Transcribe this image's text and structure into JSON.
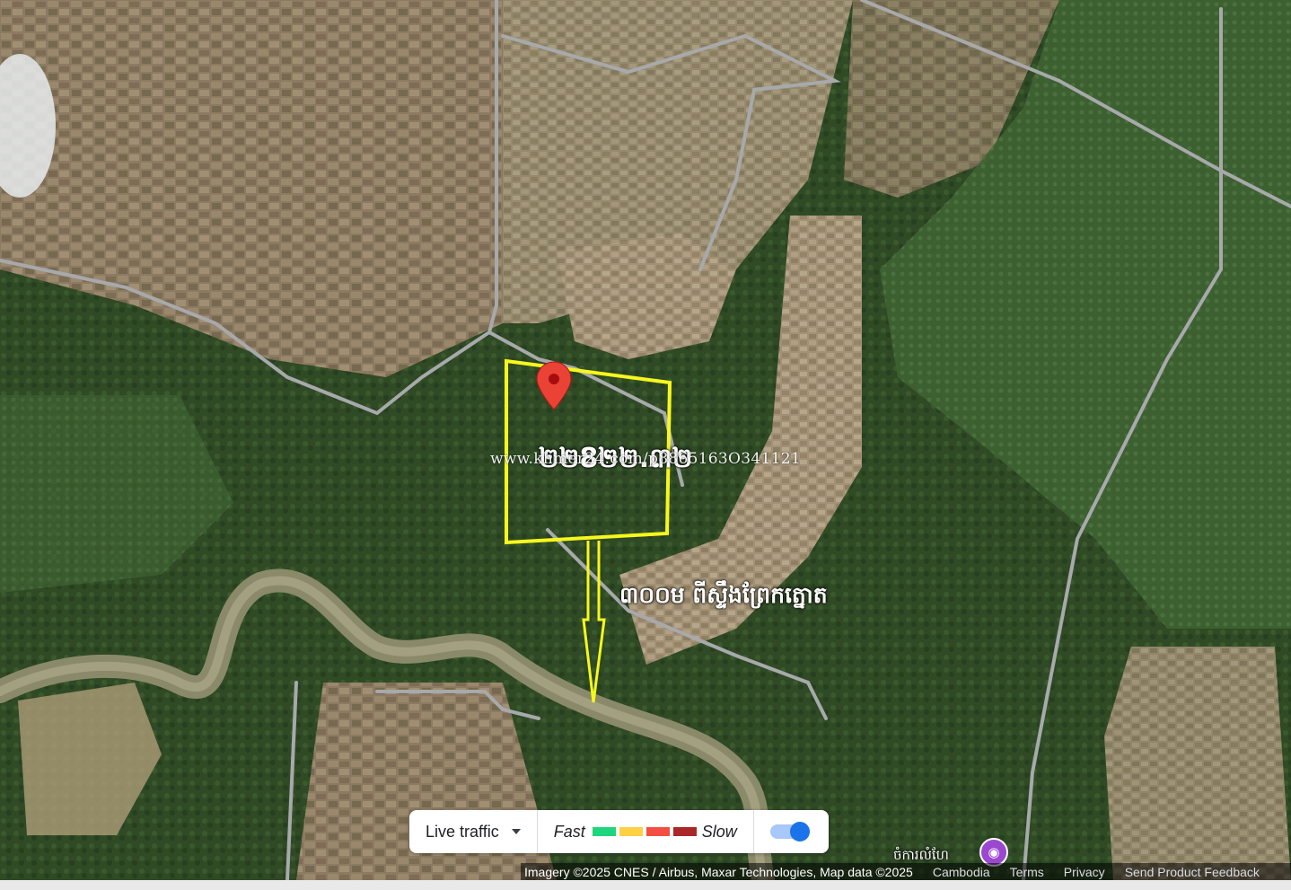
{
  "map": {
    "type": "satellite",
    "area_label": "២២8២២.៣២",
    "distance_label": "៣០០ម ពីស្ទឹងព្រែកត្នោត",
    "watermark": "www.khmer24.com/p8865163O341121",
    "colors": {
      "annotation": "#f7f71d",
      "pin": "#ea4335",
      "river": "#8a8a6a",
      "forest": "#2f4a25"
    }
  },
  "traffic": {
    "live_label": "Live traffic",
    "fast_label": "Fast",
    "slow_label": "Slow",
    "legend_colors": [
      "#1ed67c",
      "#ffcf44",
      "#f24e42",
      "#a92727"
    ],
    "toggle_on": true
  },
  "poi": {
    "label": "ចំការលំហែ",
    "icon": "camera-icon"
  },
  "attribution": {
    "imagery": "Imagery ©2025 CNES / Airbus, Maxar Technologies, Map data ©2025",
    "country": "Cambodia",
    "terms": "Terms",
    "privacy": "Privacy",
    "feedback": "Send Product Feedback"
  }
}
